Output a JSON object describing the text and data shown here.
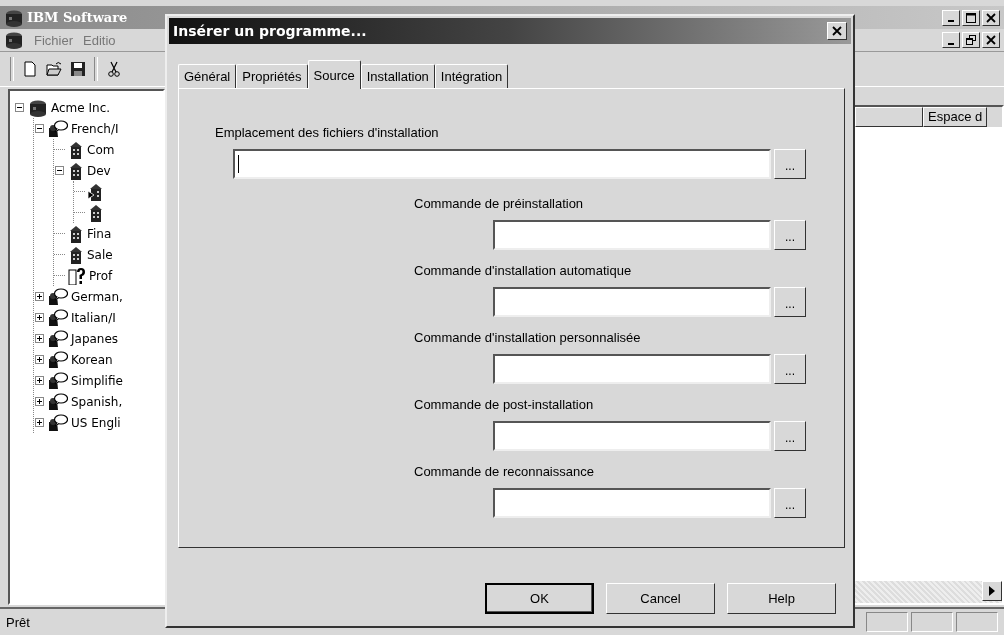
{
  "app_window": {
    "title": "IBM Software",
    "menu": [
      "Fichier",
      "Editio"
    ],
    "tree": [
      {
        "label": "Acme Inc.",
        "kind": "company",
        "expanded": true,
        "children": [
          {
            "label": "French/I",
            "kind": "region",
            "expanded": true,
            "children": [
              {
                "label": "Com",
                "kind": "building"
              },
              {
                "label": "Dev",
                "kind": "building",
                "expanded": true,
                "children": [
                  {
                    "kind": "building-arrow"
                  },
                  {
                    "kind": "building"
                  }
                ]
              },
              {
                "label": "Fina",
                "kind": "building"
              },
              {
                "label": "Sale",
                "kind": "building"
              },
              {
                "label": "Prof",
                "kind": "unknown"
              }
            ]
          },
          {
            "label": "German,",
            "kind": "region",
            "expanded": false
          },
          {
            "label": "Italian/I",
            "kind": "region",
            "expanded": false
          },
          {
            "label": "Japanes",
            "kind": "region",
            "expanded": false
          },
          {
            "label": "Korean",
            "kind": "region",
            "expanded": false
          },
          {
            "label": "Simplifie",
            "kind": "region",
            "expanded": false
          },
          {
            "label": "Spanish,",
            "kind": "region",
            "expanded": false
          },
          {
            "label": "US Engli",
            "kind": "region",
            "expanded": false
          }
        ]
      }
    ],
    "list_columns": [
      "Espace d"
    ],
    "status_bar": "Prêt"
  },
  "dialog": {
    "title": "Insérer un programme...",
    "tabs": [
      {
        "label": "Général",
        "selected": false
      },
      {
        "label": "Propriétés",
        "selected": false
      },
      {
        "label": "Source",
        "selected": true
      },
      {
        "label": "Installation",
        "selected": false
      },
      {
        "label": "Intégration",
        "selected": false
      }
    ],
    "fields": [
      {
        "label": "Emplacement des fichiers d'installation",
        "kind": "wide",
        "focused": true,
        "browse": "..."
      },
      {
        "label": "Commande de préinstallation",
        "kind": "indented",
        "focused": false,
        "browse": "..."
      },
      {
        "label": "Commande d'installation automatique",
        "kind": "indented",
        "focused": false,
        "browse": "..."
      },
      {
        "label": "Commande d'installation personnalisée",
        "kind": "indented",
        "focused": false,
        "browse": "..."
      },
      {
        "label": "Commande de post-installation",
        "kind": "indented",
        "focused": false,
        "browse": "..."
      },
      {
        "label": "Commande de reconnaissance",
        "kind": "indented",
        "focused": false,
        "browse": "..."
      }
    ],
    "buttons": [
      {
        "label": "OK",
        "default": true
      },
      {
        "label": "Cancel",
        "default": false
      },
      {
        "label": "Help",
        "default": false
      }
    ]
  }
}
